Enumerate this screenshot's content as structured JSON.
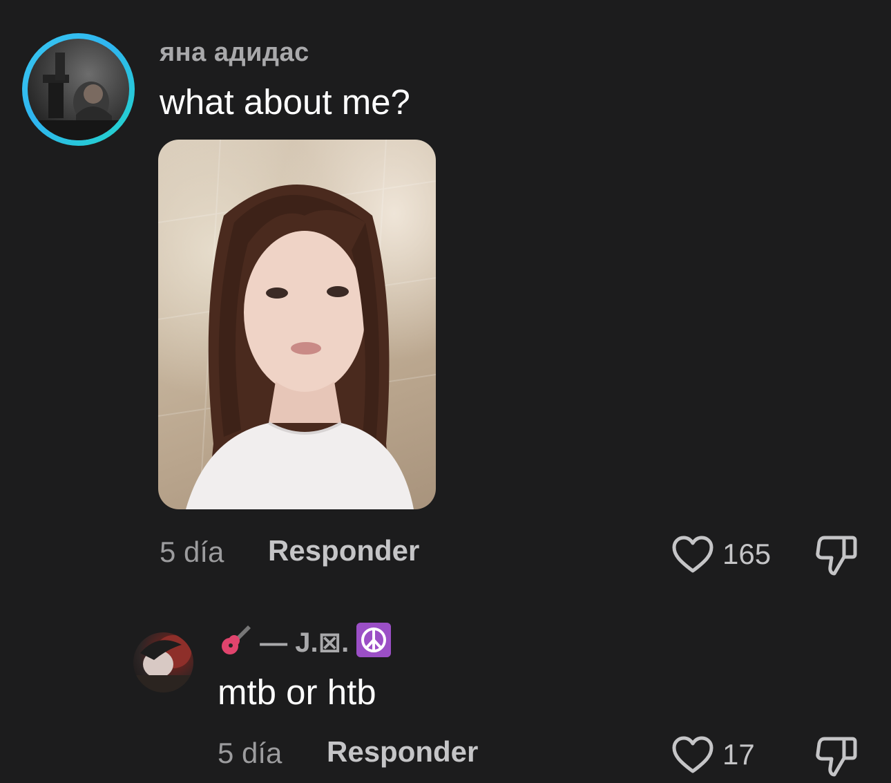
{
  "comment": {
    "username": "яна адидас",
    "text": "what about me?",
    "time": "5 día",
    "reply_label": "Responder",
    "likes": "165"
  },
  "reply": {
    "username": "— J.⊠.",
    "text": "mtb or htb",
    "time": "5 día",
    "reply_label": "Responder",
    "likes": "17"
  },
  "icons": {
    "like": "heart-outline-icon",
    "dislike": "thumbs-down-outline-icon",
    "username_emojis": [
      "guitar-emoji",
      "peace-symbol-emoji"
    ]
  },
  "colors": {
    "background": "#1c1c1d",
    "story_ring_start": "#38c7ef",
    "story_ring_end": "#22d6c8",
    "username": "#a9a9ab",
    "secondary_text": "#9c9c9e"
  }
}
